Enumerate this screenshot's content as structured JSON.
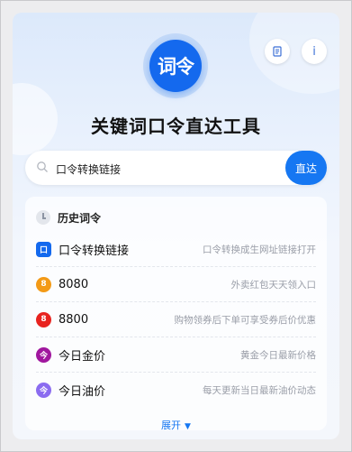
{
  "app": {
    "title": "关键词口令直达工具",
    "logo_text_a": "词",
    "logo_text_b": "令"
  },
  "header_buttons": {
    "doc_icon": "doc-icon",
    "info_label": "i"
  },
  "search": {
    "value": "口令转换链接",
    "placeholder": "",
    "submit_label": "直达"
  },
  "history": {
    "title": "历史词令",
    "items": [
      {
        "badge": "口",
        "name": "口令转换链接",
        "desc": "口令转换成生网址链接打开",
        "color": "#1469ee"
      },
      {
        "badge": "8",
        "name": "8080",
        "desc": "外卖红包天天领入口",
        "color": "#f39a17"
      },
      {
        "badge": "8",
        "name": "8800",
        "desc": "购物领券后下单可享受券后价优惠",
        "color": "#e8231f"
      },
      {
        "badge": "今",
        "name": "今日金价",
        "desc": "黄金今日最新价格",
        "color": "#a0179e"
      },
      {
        "badge": "今",
        "name": "今日油价",
        "desc": "每天更新当日最新油价动态",
        "color": "#8b6cf0"
      }
    ],
    "expand_label": "展开"
  }
}
